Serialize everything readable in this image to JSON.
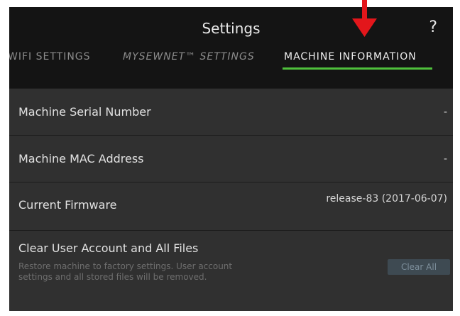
{
  "header": {
    "title": "Settings",
    "help_label": "?",
    "tabs": [
      {
        "label": "WIFI SETTINGS",
        "active": false
      },
      {
        "label": "MYSEWNET™ SETTINGS",
        "active": false
      },
      {
        "label": "MACHINE INFORMATION",
        "active": true
      }
    ],
    "indicator_color": "#4fc03c"
  },
  "annotation": {
    "arrow_color": "#e3161b"
  },
  "rows": [
    {
      "label": "Machine Serial Number",
      "value": "-"
    },
    {
      "label": "Machine MAC Address",
      "value": "-"
    },
    {
      "label": "Current Firmware",
      "value": "release-83 (2017-06-07)"
    },
    {
      "label": "Clear User Account and All Files",
      "description": "Restore machine to factory settings. User account settings and all stored files will be removed.",
      "button_label": "Clear All"
    }
  ]
}
